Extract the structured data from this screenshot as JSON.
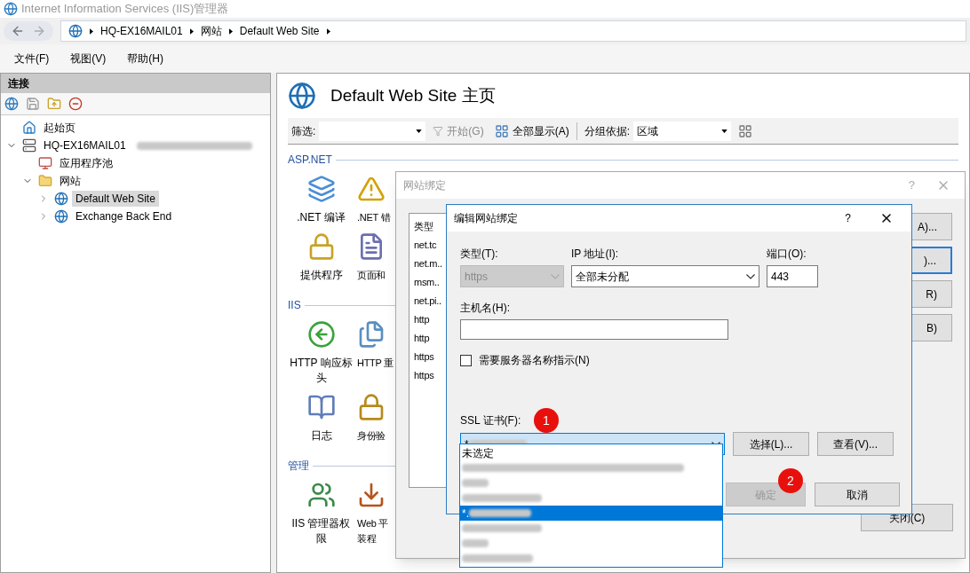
{
  "window": {
    "title": "Internet Information Services (IIS)管理器"
  },
  "address_bar": {
    "crumbs": [
      "HQ-EX16MAIL01",
      "网站",
      "Default Web Site"
    ]
  },
  "menu": [
    "文件(F)",
    "视图(V)",
    "帮助(H)"
  ],
  "connections": {
    "title": "连接",
    "tree": [
      {
        "label": "起始页",
        "kind": "start",
        "selected": false
      },
      {
        "label": "HQ-EX16MAIL01",
        "kind": "server",
        "blurred_suffix": true,
        "selected": false,
        "expanded": true,
        "children": [
          {
            "label": "应用程序池",
            "kind": "pool",
            "selected": false
          },
          {
            "label": "网站",
            "kind": "folder",
            "selected": false,
            "expanded": true,
            "children": [
              {
                "label": "Default Web Site",
                "kind": "site",
                "selected": true,
                "expanded": false
              },
              {
                "label": "Exchange Back End",
                "kind": "site",
                "selected": false,
                "expanded": false
              }
            ]
          }
        ]
      }
    ]
  },
  "page": {
    "title": "Default Web Site 主页",
    "filter": {
      "label": "筛选:",
      "start": "开始(G)",
      "show_all": "全部显示(A)",
      "group_label": "分组依据:",
      "group_value": "区域"
    },
    "sections": [
      {
        "title": "ASP.NET",
        "rows": [
          [
            {
              "label": ".NET 编译"
            },
            {
              "label": ".NET 错"
            }
          ],
          [
            {
              "label": "提供程序"
            },
            {
              "label": "页面和"
            }
          ]
        ]
      },
      {
        "title": "IIS",
        "rows": [
          [
            {
              "label": "HTTP 响应标头"
            },
            {
              "label": "HTTP 重"
            }
          ],
          [
            {
              "label": "日志"
            },
            {
              "label": "身份验"
            }
          ]
        ]
      },
      {
        "title": "管理",
        "rows": [
          [
            {
              "label": "IIS 管理器权限"
            },
            {
              "lines": [
                "Web 平",
                "装程"
              ]
            }
          ]
        ]
      }
    ]
  },
  "bindings_dialog": {
    "title": "网站绑定",
    "help": "?",
    "list_header": "类型",
    "rows": [
      "net.tc",
      "net.m..",
      "msm..",
      "net.pi..",
      "http",
      "http",
      "https",
      "https"
    ],
    "buttons": [
      {
        "label": "A)...",
        "focused": false
      },
      {
        "label": ")...",
        "focused": true
      },
      {
        "label": "R)",
        "focused": false
      },
      {
        "label": "B)",
        "focused": false
      }
    ],
    "close": "关闭(C)"
  },
  "edit_dialog": {
    "title": "编辑网站绑定",
    "help": "?",
    "type": {
      "label": "类型(T):",
      "value": "https",
      "disabled": true
    },
    "ip": {
      "label": "IP 地址(I):",
      "value": "全部未分配"
    },
    "port": {
      "label": "端口(O):",
      "value": "443"
    },
    "host": {
      "label": "主机名(H):"
    },
    "sni": {
      "label": "需要服务器名称指示(N)",
      "checked": false
    },
    "ssl": {
      "label": "SSL 证书(F):",
      "prefix": "*",
      "blurred": true,
      "options": [
        {
          "kind": "plain",
          "text": "未选定",
          "selected": false
        },
        {
          "kind": "blurred",
          "selected": false
        },
        {
          "kind": "blurred",
          "selected": false
        },
        {
          "kind": "blurred",
          "selected": false
        },
        {
          "kind": "blurred",
          "prefix": "*.",
          "selected": true
        },
        {
          "kind": "blurred",
          "selected": false
        },
        {
          "kind": "blurred",
          "selected": false
        },
        {
          "kind": "blurred",
          "selected": false
        }
      ]
    },
    "select_button": "选择(L)...",
    "view_button": "查看(V)...",
    "ok": {
      "label": "确定",
      "disabled": true
    },
    "cancel": "取消"
  },
  "callouts": [
    "1",
    "2"
  ]
}
